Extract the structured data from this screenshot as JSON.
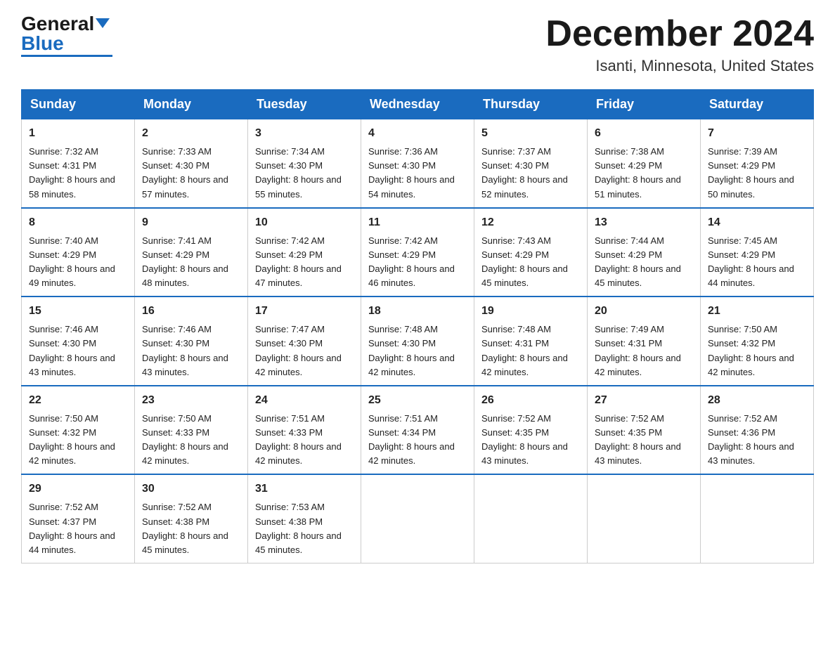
{
  "logo": {
    "general": "General",
    "blue": "Blue"
  },
  "title": {
    "month_year": "December 2024",
    "location": "Isanti, Minnesota, United States"
  },
  "weekdays": [
    "Sunday",
    "Monday",
    "Tuesday",
    "Wednesday",
    "Thursday",
    "Friday",
    "Saturday"
  ],
  "weeks": [
    [
      {
        "day": "1",
        "sunrise": "7:32 AM",
        "sunset": "4:31 PM",
        "daylight": "8 hours and 58 minutes."
      },
      {
        "day": "2",
        "sunrise": "7:33 AM",
        "sunset": "4:30 PM",
        "daylight": "8 hours and 57 minutes."
      },
      {
        "day": "3",
        "sunrise": "7:34 AM",
        "sunset": "4:30 PM",
        "daylight": "8 hours and 55 minutes."
      },
      {
        "day": "4",
        "sunrise": "7:36 AM",
        "sunset": "4:30 PM",
        "daylight": "8 hours and 54 minutes."
      },
      {
        "day": "5",
        "sunrise": "7:37 AM",
        "sunset": "4:30 PM",
        "daylight": "8 hours and 52 minutes."
      },
      {
        "day": "6",
        "sunrise": "7:38 AM",
        "sunset": "4:29 PM",
        "daylight": "8 hours and 51 minutes."
      },
      {
        "day": "7",
        "sunrise": "7:39 AM",
        "sunset": "4:29 PM",
        "daylight": "8 hours and 50 minutes."
      }
    ],
    [
      {
        "day": "8",
        "sunrise": "7:40 AM",
        "sunset": "4:29 PM",
        "daylight": "8 hours and 49 minutes."
      },
      {
        "day": "9",
        "sunrise": "7:41 AM",
        "sunset": "4:29 PM",
        "daylight": "8 hours and 48 minutes."
      },
      {
        "day": "10",
        "sunrise": "7:42 AM",
        "sunset": "4:29 PM",
        "daylight": "8 hours and 47 minutes."
      },
      {
        "day": "11",
        "sunrise": "7:42 AM",
        "sunset": "4:29 PM",
        "daylight": "8 hours and 46 minutes."
      },
      {
        "day": "12",
        "sunrise": "7:43 AM",
        "sunset": "4:29 PM",
        "daylight": "8 hours and 45 minutes."
      },
      {
        "day": "13",
        "sunrise": "7:44 AM",
        "sunset": "4:29 PM",
        "daylight": "8 hours and 45 minutes."
      },
      {
        "day": "14",
        "sunrise": "7:45 AM",
        "sunset": "4:29 PM",
        "daylight": "8 hours and 44 minutes."
      }
    ],
    [
      {
        "day": "15",
        "sunrise": "7:46 AM",
        "sunset": "4:30 PM",
        "daylight": "8 hours and 43 minutes."
      },
      {
        "day": "16",
        "sunrise": "7:46 AM",
        "sunset": "4:30 PM",
        "daylight": "8 hours and 43 minutes."
      },
      {
        "day": "17",
        "sunrise": "7:47 AM",
        "sunset": "4:30 PM",
        "daylight": "8 hours and 42 minutes."
      },
      {
        "day": "18",
        "sunrise": "7:48 AM",
        "sunset": "4:30 PM",
        "daylight": "8 hours and 42 minutes."
      },
      {
        "day": "19",
        "sunrise": "7:48 AM",
        "sunset": "4:31 PM",
        "daylight": "8 hours and 42 minutes."
      },
      {
        "day": "20",
        "sunrise": "7:49 AM",
        "sunset": "4:31 PM",
        "daylight": "8 hours and 42 minutes."
      },
      {
        "day": "21",
        "sunrise": "7:50 AM",
        "sunset": "4:32 PM",
        "daylight": "8 hours and 42 minutes."
      }
    ],
    [
      {
        "day": "22",
        "sunrise": "7:50 AM",
        "sunset": "4:32 PM",
        "daylight": "8 hours and 42 minutes."
      },
      {
        "day": "23",
        "sunrise": "7:50 AM",
        "sunset": "4:33 PM",
        "daylight": "8 hours and 42 minutes."
      },
      {
        "day": "24",
        "sunrise": "7:51 AM",
        "sunset": "4:33 PM",
        "daylight": "8 hours and 42 minutes."
      },
      {
        "day": "25",
        "sunrise": "7:51 AM",
        "sunset": "4:34 PM",
        "daylight": "8 hours and 42 minutes."
      },
      {
        "day": "26",
        "sunrise": "7:52 AM",
        "sunset": "4:35 PM",
        "daylight": "8 hours and 43 minutes."
      },
      {
        "day": "27",
        "sunrise": "7:52 AM",
        "sunset": "4:35 PM",
        "daylight": "8 hours and 43 minutes."
      },
      {
        "day": "28",
        "sunrise": "7:52 AM",
        "sunset": "4:36 PM",
        "daylight": "8 hours and 43 minutes."
      }
    ],
    [
      {
        "day": "29",
        "sunrise": "7:52 AM",
        "sunset": "4:37 PM",
        "daylight": "8 hours and 44 minutes."
      },
      {
        "day": "30",
        "sunrise": "7:52 AM",
        "sunset": "4:38 PM",
        "daylight": "8 hours and 45 minutes."
      },
      {
        "day": "31",
        "sunrise": "7:53 AM",
        "sunset": "4:38 PM",
        "daylight": "8 hours and 45 minutes."
      },
      null,
      null,
      null,
      null
    ]
  ]
}
